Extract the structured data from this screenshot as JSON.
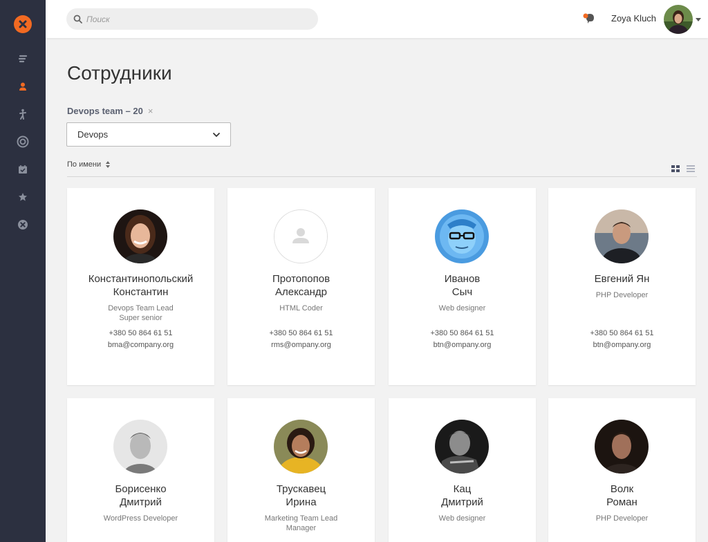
{
  "colors": {
    "accent": "#f26a22",
    "sidebar": "#2c3040",
    "sidebar_icon": "#8a8f9c"
  },
  "sidebar": {
    "items": [
      {
        "icon": "list-icon"
      },
      {
        "icon": "user-icon",
        "active": true
      },
      {
        "icon": "person-icon"
      },
      {
        "icon": "target-icon"
      },
      {
        "icon": "calendar-check-icon"
      },
      {
        "icon": "star-icon"
      },
      {
        "icon": "close-circle-icon"
      }
    ]
  },
  "topbar": {
    "search_placeholder": "Поиск",
    "username": "Zoya Kluch"
  },
  "main": {
    "title": "Сотрудники",
    "filter_tag": "Devops team – 20",
    "filter_remove": "×",
    "select_value": "Devops",
    "sort_label": "По имени"
  },
  "employees": [
    {
      "name1": "Константинопольский",
      "name2": "Константин",
      "role1": "Devops Team Lead",
      "role2": "Super senior",
      "phone": "+380 50 864 61 51",
      "email": "bma@company.org"
    },
    {
      "name1": "Протопопов",
      "name2": "Александр",
      "role1": "HTML Coder",
      "role2": "",
      "phone": "+380 50 864 61 51",
      "email": "rms@ompany.org"
    },
    {
      "name1": "Иванов",
      "name2": "Сыч",
      "role1": "Web designer",
      "role2": "",
      "phone": "+380 50 864 61 51",
      "email": "btn@ompany.org"
    },
    {
      "name1": "Евгений Ян",
      "name2": "",
      "role1": "PHP Developer",
      "role2": "",
      "phone": "+380 50 864 61 51",
      "email": "btn@ompany.org"
    },
    {
      "name1": "Борисенко",
      "name2": "Дмитрий",
      "role1": "WordPress Developer",
      "role2": "",
      "phone": "",
      "email": ""
    },
    {
      "name1": "Трускавец",
      "name2": "Ирина",
      "role1": "Marketing Team Lead",
      "role2": "Manager",
      "phone": "",
      "email": ""
    },
    {
      "name1": "Кац",
      "name2": "Дмитрий",
      "role1": "Web designer",
      "role2": "",
      "phone": "",
      "email": ""
    },
    {
      "name1": "Волк",
      "name2": "Роман",
      "role1": "PHP Developer",
      "role2": "",
      "phone": "",
      "email": ""
    }
  ]
}
